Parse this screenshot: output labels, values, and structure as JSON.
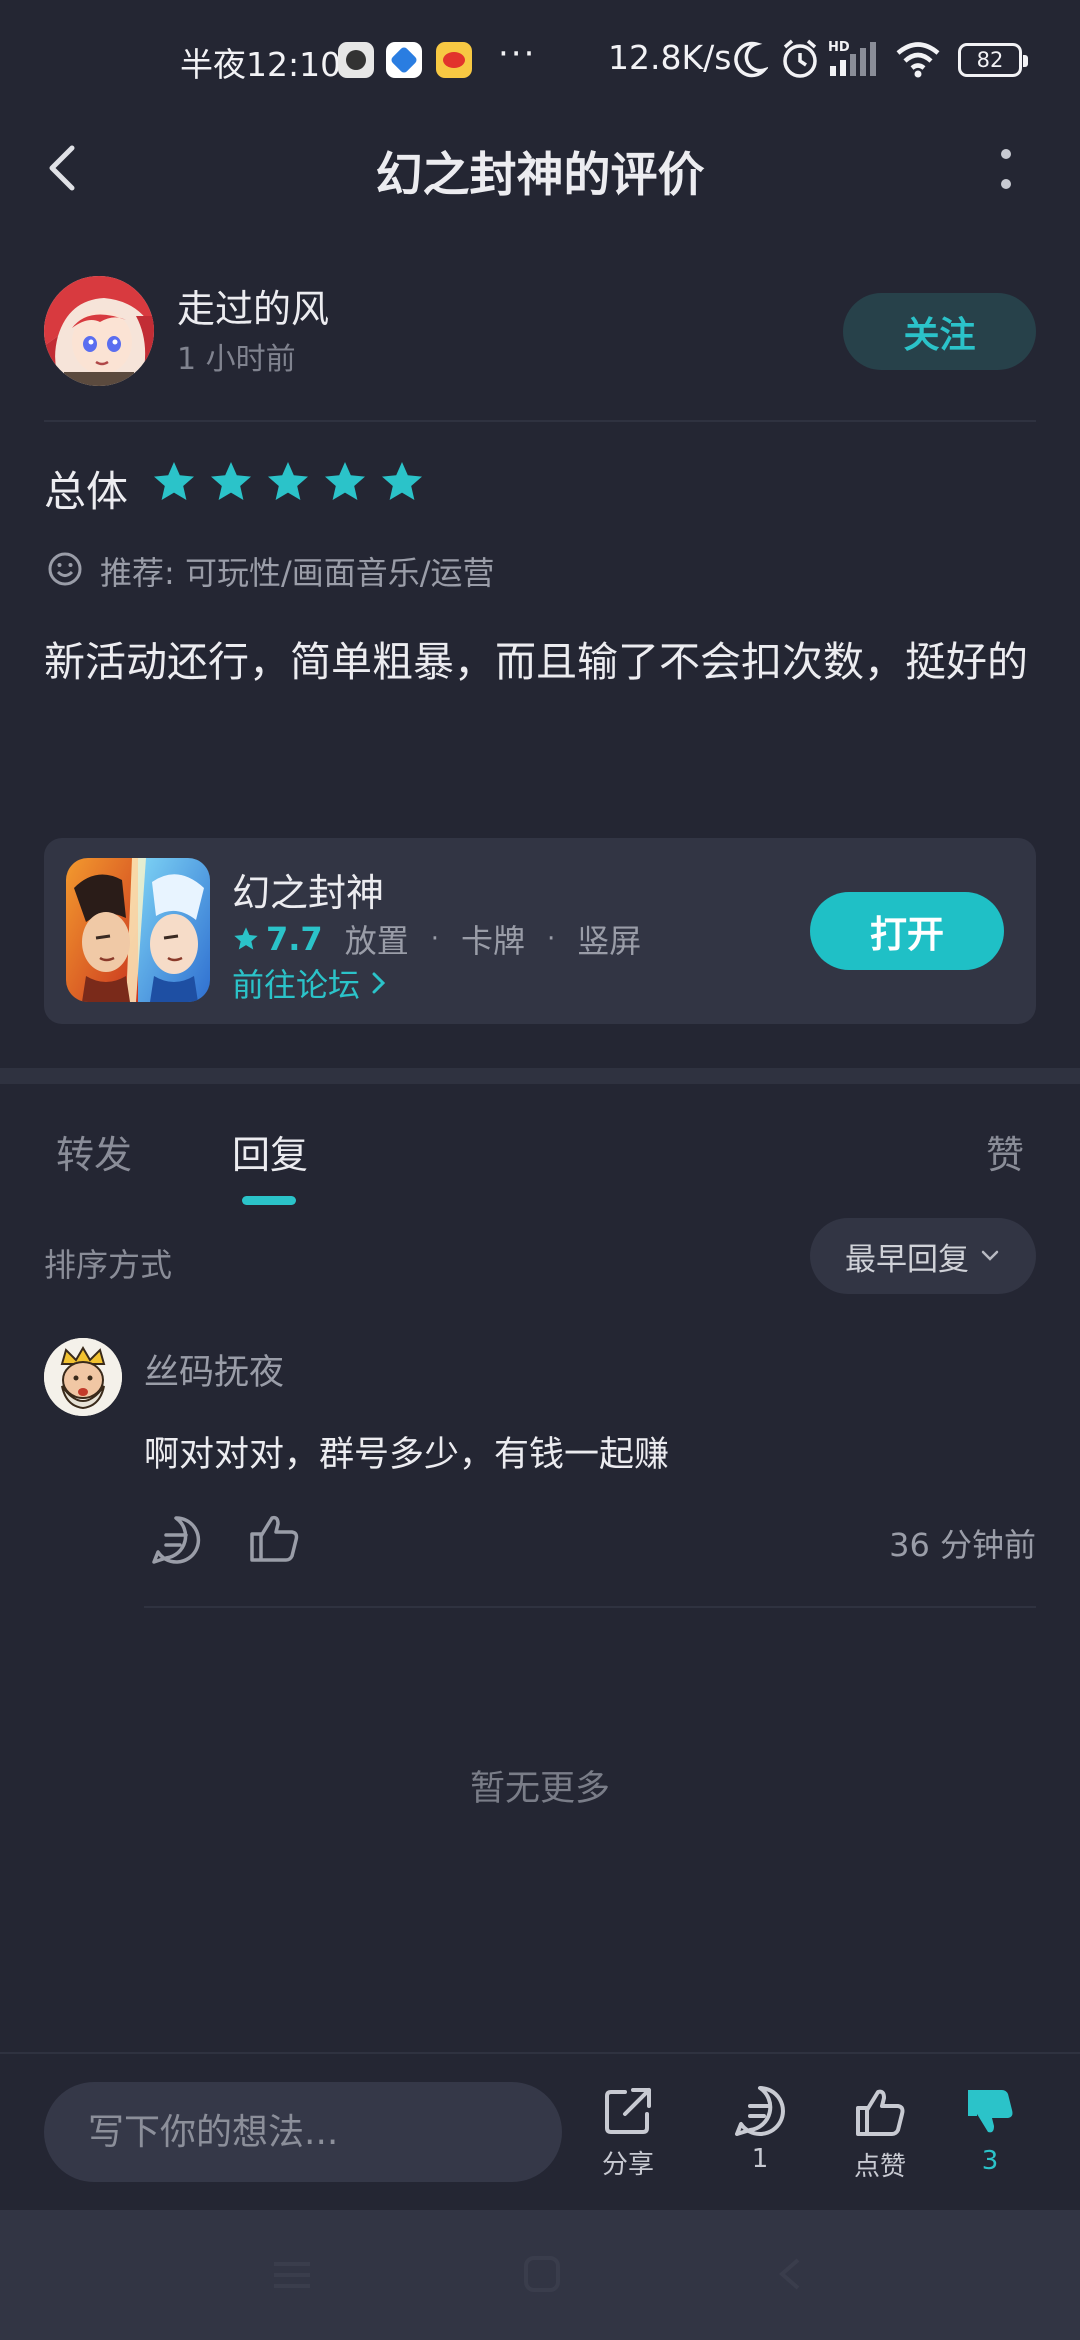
{
  "status_bar": {
    "time": "半夜12:10",
    "more": "···",
    "net_speed": "12.8K/s",
    "battery": "82"
  },
  "header": {
    "title": "幻之封神的评价"
  },
  "review": {
    "author_name": "走过的风",
    "author_time": "1 小时前",
    "follow_label": "关注",
    "overall_label": "总体",
    "star_rating": 5,
    "recommend": "推荐: 可玩性/画面音乐/运营",
    "body": "新活动还行，简单粗暴，而且输了不会扣次数，挺好的"
  },
  "game_card": {
    "name": "幻之封神",
    "score": "7.7",
    "tags": [
      "放置",
      "·",
      "卡牌",
      "·",
      "竖屏"
    ],
    "forum_link": "前往论坛",
    "open_label": "打开"
  },
  "tabs": {
    "forward": "转发",
    "reply": "回复",
    "likes": "赞"
  },
  "sort": {
    "label": "排序方式",
    "selected": "最早回复"
  },
  "comments": [
    {
      "name": "丝码抚夜",
      "text": "啊对对对，群号多少，有钱一起赚",
      "time": "36 分钟前"
    }
  ],
  "no_more": "暂无更多",
  "bottom_bar": {
    "input_placeholder": "写下你的想法...",
    "share_label": "分享",
    "comment_count": "1",
    "like_label": "点赞",
    "dislike_count": "3"
  },
  "colors": {
    "background": "#242633",
    "accent": "#2bc3c9",
    "card": "#323544"
  }
}
